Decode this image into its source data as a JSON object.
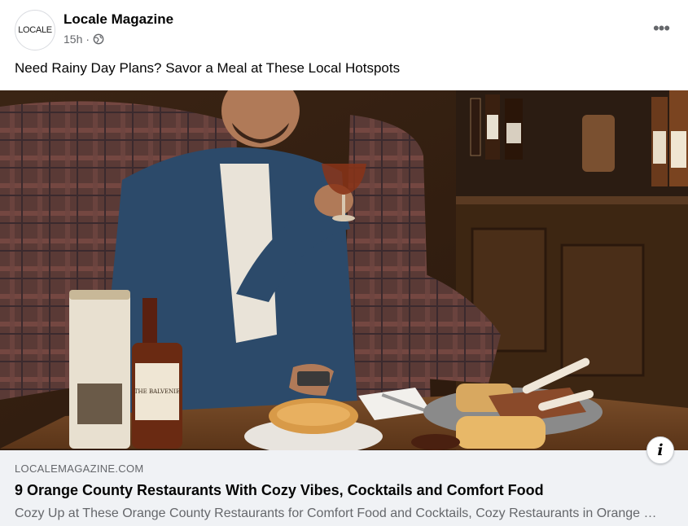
{
  "post": {
    "page_name": "Locale Magazine",
    "avatar_text": "LOCALE",
    "time": "15h",
    "separator": "·",
    "audience_icon": "globe-icon",
    "more_icon": "more-horizontal-icon",
    "more_label": "•••",
    "caption": "Need Rainy Day Plans? Savor a Meal at These Local Hotspots"
  },
  "photo": {
    "bottle_label": "THE BALVENIE"
  },
  "link_preview": {
    "info_icon": "info-icon",
    "info_label": "i",
    "domain": "LOCALEMAGAZINE.COM",
    "title": "9 Orange County Restaurants With Cozy Vibes, Cocktails and Comfort Food",
    "description": "Cozy Up at These Orange County Restaurants for Comfort Food and Cocktails, Cozy Restaurants in Orange County"
  },
  "colors": {
    "link_bg": "#f0f2f5",
    "secondary_text": "#65676b",
    "primary_text": "#050505"
  }
}
